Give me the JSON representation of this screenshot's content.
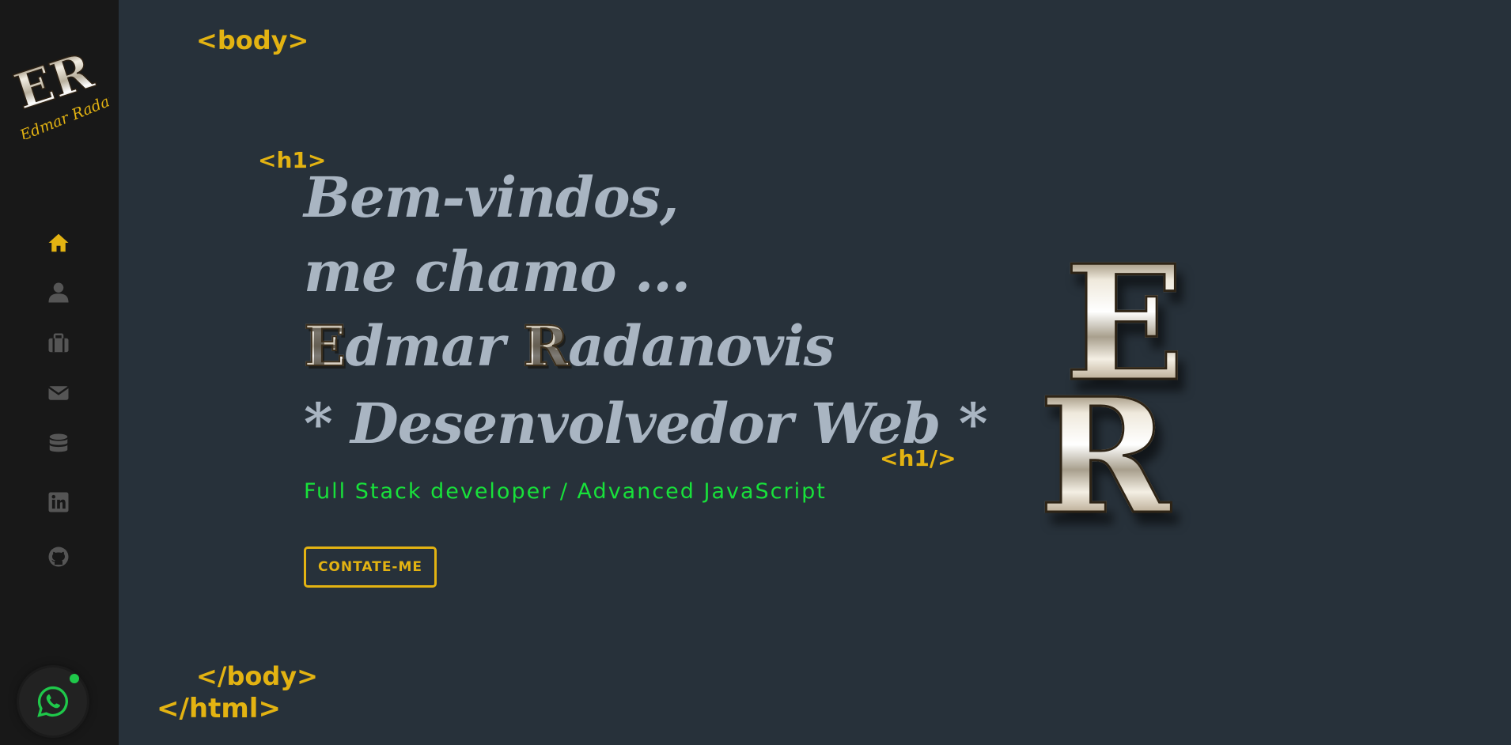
{
  "sidebar": {
    "logo": {
      "initials": "ER",
      "signature": "Edmar Radanovis"
    },
    "nav": [
      {
        "name": "home",
        "icon": "home-icon",
        "active": true
      },
      {
        "name": "about",
        "icon": "user-icon",
        "active": false
      },
      {
        "name": "portfolio",
        "icon": "briefcase-icon",
        "active": false
      },
      {
        "name": "contact",
        "icon": "envelope-icon",
        "active": false
      },
      {
        "name": "database",
        "icon": "database-icon",
        "active": false
      },
      {
        "name": "linkedin",
        "icon": "linkedin-icon",
        "active": false
      },
      {
        "name": "github",
        "icon": "github-icon",
        "active": false
      }
    ],
    "whatsapp_icon": "whatsapp-icon"
  },
  "code_tags": {
    "body_open": "<body>",
    "h1_open": "<h1>",
    "h1_close": "<h1/>",
    "body_close": "</body>",
    "html_close": "</html>"
  },
  "hero": {
    "line1": "Bem-vindos,",
    "line2": "me chamo ...",
    "first_initial": "E",
    "first_rest": "dmar",
    "last_initial": "R",
    "last_rest": "adanovis",
    "line4": "* Desenvolvedor Web *",
    "subtitle": "Full Stack developer / Advanced JavaScript",
    "cta_label": "CONTATE-ME"
  },
  "big_logo": {
    "top_letter": "E",
    "bottom_letter": "R"
  },
  "colors": {
    "background": "#27313a",
    "sidebar": "#181818",
    "accent": "#e3b312",
    "heading": "#a9b5c2",
    "subtitle": "#18e13a",
    "icon_inactive": "#555555",
    "online_dot": "#1fc84a"
  }
}
